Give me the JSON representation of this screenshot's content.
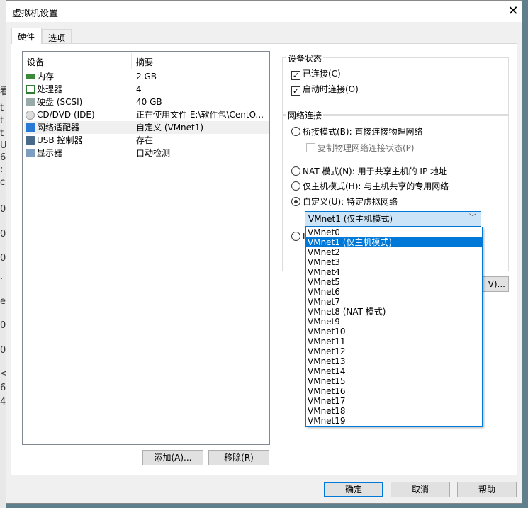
{
  "background_chars": [
    "看",
    "t",
    "t",
    "t",
    "U",
    "6",
    ":",
    "c",
    "0",
    "0",
    "0",
    ".",
    "e",
    "0",
    "0",
    "<",
    "6",
    "4"
  ],
  "window": {
    "title": "虚拟机设置",
    "close": "✕"
  },
  "tabs": [
    {
      "label": "硬件",
      "active": true
    },
    {
      "label": "选项",
      "active": false
    }
  ],
  "device_list": {
    "headers": [
      "设备",
      "摘要"
    ],
    "rows": [
      {
        "icon": "memory-icon",
        "device": "内存",
        "summary": "2 GB"
      },
      {
        "icon": "processor-icon",
        "device": "处理器",
        "summary": "4"
      },
      {
        "icon": "hard-disk-icon",
        "device": "硬盘 (SCSI)",
        "summary": "40 GB"
      },
      {
        "icon": "cd-dvd-icon",
        "device": "CD/DVD (IDE)",
        "summary": "正在使用文件 E:\\软件包\\CentO..."
      },
      {
        "icon": "network-adapter-icon",
        "device": "网络适配器",
        "summary": "自定义 (VMnet1)",
        "selected": true
      },
      {
        "icon": "usb-icon",
        "device": "USB 控制器",
        "summary": "存在"
      },
      {
        "icon": "display-icon",
        "device": "显示器",
        "summary": "自动检测"
      }
    ],
    "add_button": "添加(A)...",
    "remove_button": "移除(R)"
  },
  "device_status": {
    "title": "设备状态",
    "connected": {
      "label": "已连接(C)",
      "checked": true
    },
    "connect_at_power_on": {
      "label": "启动时连接(O)",
      "checked": true
    }
  },
  "network": {
    "title": "网络连接",
    "bridged": "桥接模式(B): 直接连接物理网络",
    "replicate": "复制物理网络连接状态(P)",
    "nat": "NAT 模式(N): 用于共享主机的 IP 地址",
    "host_only": "仅主机模式(H): 与主机共享的专用网络",
    "custom": "自定义(U): 特定虚拟网络",
    "lan_partial": "L",
    "selected_network": "VMnet1 (仅主机模式)",
    "advanced_partial": "V)...",
    "options": [
      "VMnet0",
      "VMnet1 (仅主机模式)",
      "VMnet2",
      "VMnet3",
      "VMnet4",
      "VMnet5",
      "VMnet6",
      "VMnet7",
      "VMnet8 (NAT 模式)",
      "VMnet9",
      "VMnet10",
      "VMnet11",
      "VMnet12",
      "VMnet13",
      "VMnet14",
      "VMnet15",
      "VMnet16",
      "VMnet17",
      "VMnet18",
      "VMnet19"
    ],
    "highlighted_index": 1
  },
  "footer": {
    "ok": "确定",
    "cancel": "取消",
    "help": "帮助"
  },
  "colors": {
    "accent": "#0078d7"
  }
}
